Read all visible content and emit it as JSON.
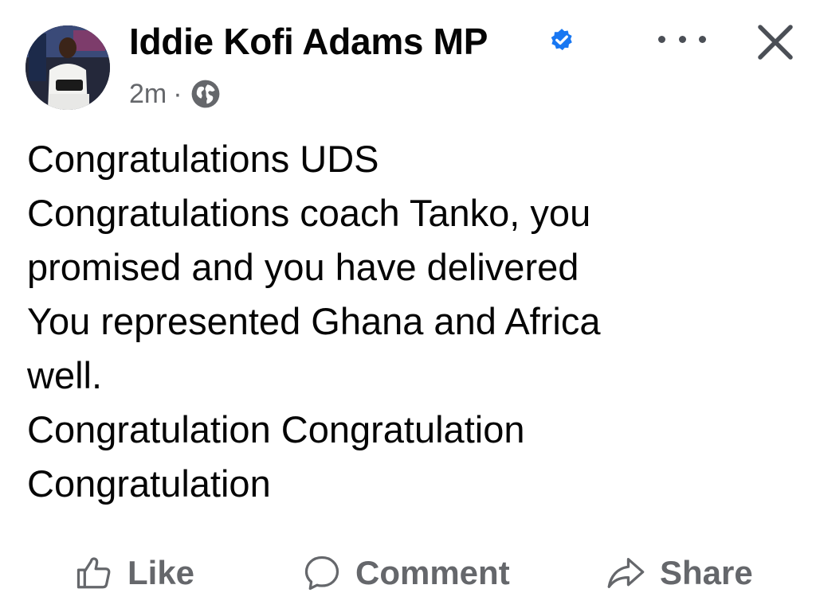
{
  "post": {
    "author_name": "Iddie Kofi Adams MP",
    "verified_icon": "verified-badge-icon",
    "timestamp": "2m",
    "separator": "·",
    "audience_icon": "globe-icon",
    "more_icon": "more-options-icon",
    "close_icon": "close-icon",
    "body_lines": [
      "Congratulations UDS",
      "Congratulations coach Tanko, you",
      "promised and you have delivered",
      "You represented Ghana and Africa",
      "well.",
      "Congratulation Congratulation",
      "Congratulation"
    ]
  },
  "actions": {
    "like": {
      "label": "Like",
      "icon": "thumbs-up-icon"
    },
    "comment": {
      "label": "Comment",
      "icon": "comment-bubble-icon"
    },
    "share": {
      "label": "Share",
      "icon": "share-arrow-icon"
    }
  },
  "colors": {
    "text_primary": "#050505",
    "text_secondary": "#65676b",
    "verified_blue": "#1877f2",
    "background": "#ffffff"
  }
}
